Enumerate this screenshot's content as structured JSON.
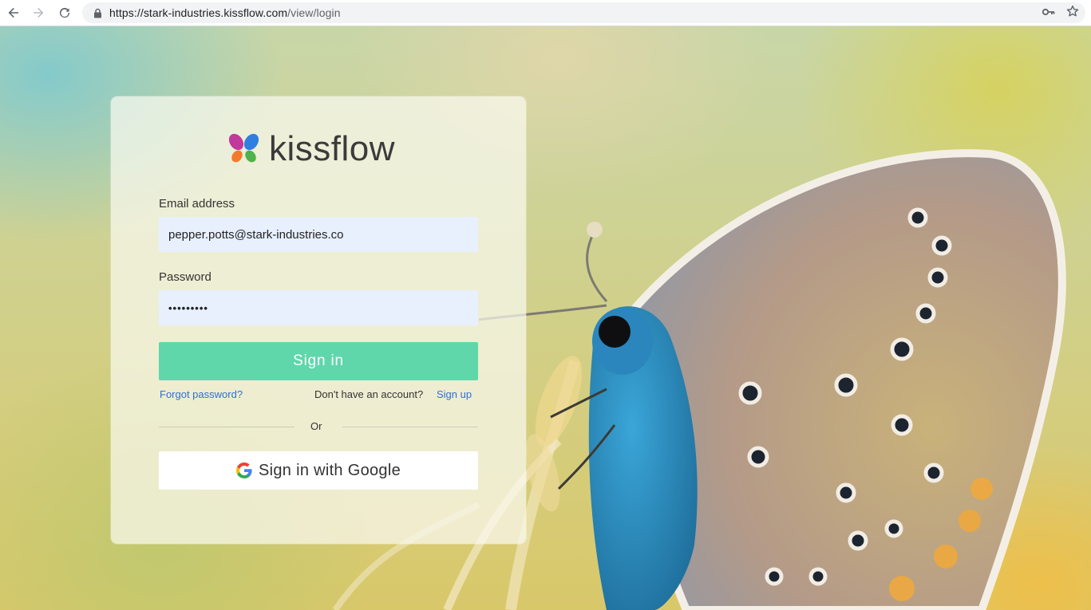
{
  "browser": {
    "url_host": "https://stark-industries.kissflow.com",
    "url_path": "/view/login"
  },
  "brand": {
    "name": "kissflow",
    "colors": {
      "petal_magenta": "#c0399b",
      "petal_blue": "#2f7fe0",
      "petal_orange": "#f47a2b",
      "petal_green": "#4fb24a",
      "primary_button": "#5fd7ab",
      "link": "#2f6fd4"
    }
  },
  "login": {
    "email_label": "Email address",
    "email_value": "pepper.potts@stark-industries.co",
    "password_label": "Password",
    "password_masked": "•••••••••",
    "signin_label": "Sign in",
    "forgot_label": "Forgot password?",
    "no_account_text": "Don't have an account?",
    "signup_label": "Sign up",
    "or_text": "Or",
    "google_label": "Sign in with Google"
  }
}
